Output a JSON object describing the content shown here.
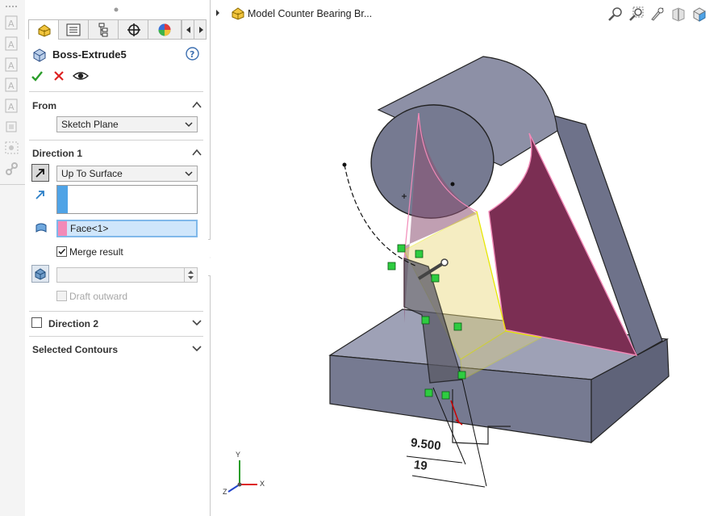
{
  "tree": {
    "title": "Model Counter Bearing Br..."
  },
  "pm": {
    "title": "Boss-Extrude5",
    "from": {
      "header": "From",
      "value": "Sketch Plane"
    },
    "dir1": {
      "header": "Direction 1",
      "end_condition": "Up To Surface",
      "face_value": "Face<1>",
      "merge_label": "Merge result",
      "draft_label": "Draft outward",
      "merge_checked": true
    },
    "dir2": {
      "header": "Direction 2"
    },
    "contours": {
      "header": "Selected Contours"
    }
  },
  "dims": {
    "d1": "9.500",
    "d2": "19"
  },
  "triad": {
    "x": "X",
    "y": "Y",
    "z": "Z"
  },
  "colors": {
    "accent_blue": "#4fa3e6",
    "face_pink": "#f28ab8",
    "preview_yellow": "#e9d97a",
    "part_grey": "#8f93a8"
  }
}
